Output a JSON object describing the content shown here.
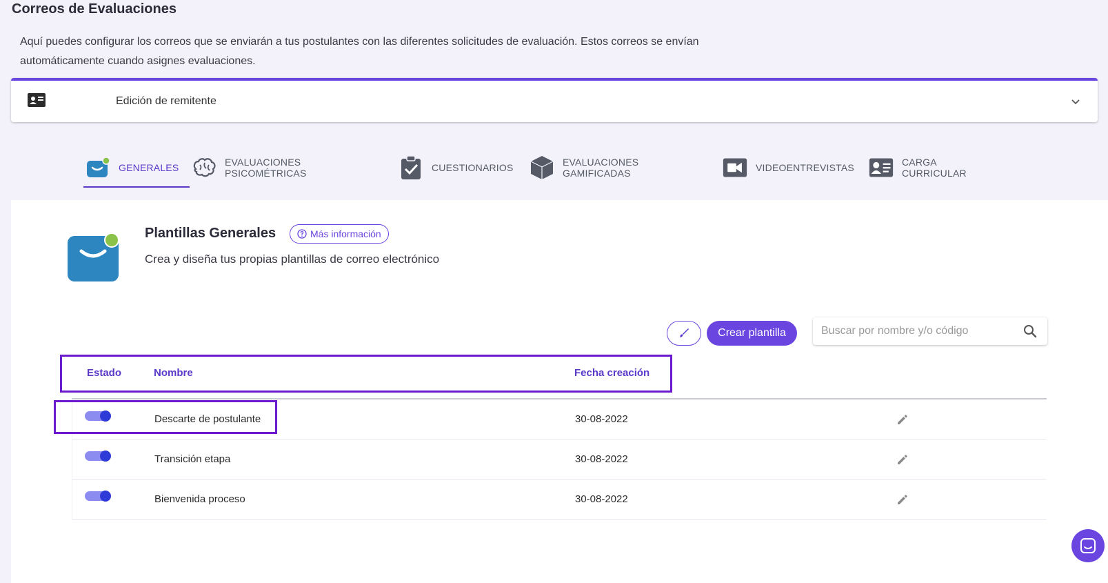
{
  "header": {
    "title": "Correos de Evaluaciones",
    "description": "Aquí puedes configurar los correos que se enviarán a tus postulantes con las diferentes solicitudes de evaluación. Estos correos se envían automáticamente cuando asignes evaluaciones."
  },
  "sender": {
    "label": "Edición de remitente"
  },
  "tabs": [
    {
      "label": "GENERALES",
      "icon": "mail-icon",
      "active": true
    },
    {
      "label": "EVALUACIONES PSICOMÉTRICAS",
      "icon": "brain-icon",
      "active": false
    },
    {
      "label": "CUESTIONARIOS",
      "icon": "clipboard-check-icon",
      "active": false
    },
    {
      "label": "EVALUACIONES GAMIFICADAS",
      "icon": "cube-icon",
      "active": false
    },
    {
      "label": "VIDEOENTREVISTAS",
      "icon": "video-icon",
      "active": false
    },
    {
      "label": "CARGA CURRICULAR",
      "icon": "id-card-icon",
      "active": false
    }
  ],
  "panel": {
    "title": "Plantillas Generales",
    "info_button": "Más información",
    "subtitle": "Crea y diseña tus propias plantillas de correo electrónico"
  },
  "toolbar": {
    "create_label": "Crear plantilla",
    "search_placeholder": "Buscar por nombre y/o código"
  },
  "table": {
    "columns": {
      "estado": "Estado",
      "nombre": "Nombre",
      "fecha": "Fecha creación"
    },
    "rows": [
      {
        "enabled": true,
        "name": "Descarte de postulante",
        "date": "30-08-2022"
      },
      {
        "enabled": true,
        "name": "Transición etapa",
        "date": "30-08-2022"
      },
      {
        "enabled": true,
        "name": "Bienvenida proceso",
        "date": "30-08-2022"
      }
    ]
  },
  "colors": {
    "accent": "#6a45e0",
    "highlight": "#6c1ad0",
    "background": "#f3f2fb",
    "mail_blue": "#2e86c1",
    "status_dot": "#8bc34a"
  }
}
